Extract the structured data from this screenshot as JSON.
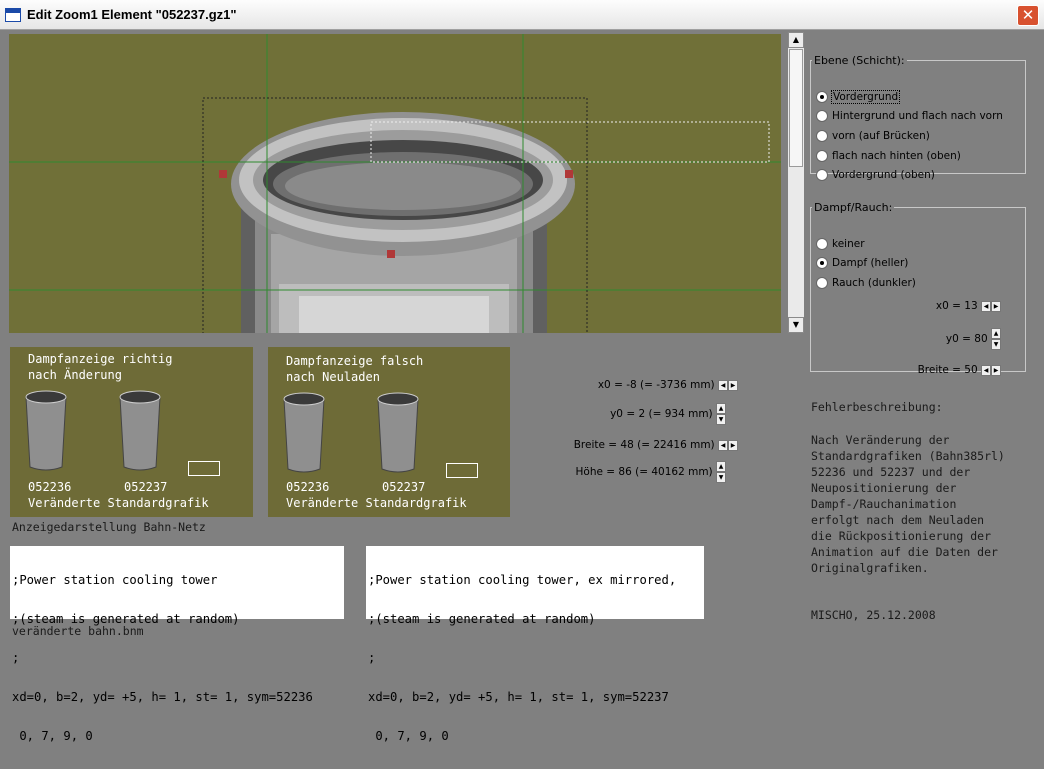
{
  "window": {
    "title": "Edit Zoom1 Element \"052237.gz1\"",
    "close_glyph": "✕"
  },
  "layer_group": {
    "legend": "Ebene (Schicht):",
    "options": [
      "Vordergrund",
      "Hintergrund und flach nach vorn",
      "vorn (auf Brücken)",
      "flach nach hinten (oben)",
      "Vordergrund (oben)"
    ],
    "selected": 0
  },
  "smoke_group": {
    "legend": "Dampf/Rauch:",
    "options": [
      "keiner",
      "Dampf (heller)",
      "Rauch (dunkler)"
    ],
    "selected": 1,
    "x0": "x0 = 13",
    "y0": "y0 = 80",
    "breite": "Breite = 50"
  },
  "fields": {
    "x0": "x0 = -8 (= -3736 mm)",
    "y0": "y0 = 2 (= 934 mm)",
    "breite": "Breite = 48 (= 22416 mm)",
    "hoehe": "Höhe = 86 (= 40162 mm)"
  },
  "panel1": {
    "line1": "Dampfanzeige richtig",
    "line2": "nach Änderung",
    "id1": "052236",
    "id2": "052237",
    "footer": "Veränderte Standardgrafik"
  },
  "panel2": {
    "line1": "Dampfanzeige falsch",
    "line2": "nach Neuladen",
    "id1": "052236",
    "id2": "052237",
    "footer": "Veränderte Standardgrafik"
  },
  "caption1": "Anzeigedarstellung Bahn-Netz",
  "code1": {
    "line1": ";Power station cooling tower",
    "line2": ";(steam is generated at random)",
    "line3": ";",
    "line4": "xd=0, b=2, yd= +5, h= 1, st= 1, sym=52236",
    "line5": " 0, 7, 9, 0"
  },
  "code2": {
    "line1": ";Power station cooling tower, ex mirrored,",
    "line2": ";(steam is generated at random)",
    "line3": ";",
    "line4": "xd=0, b=2, yd= +5, h= 1, st= 1, sym=52237",
    "line5": " 0, 7, 9, 0"
  },
  "caption2": "veränderte bahn.bnm",
  "description": {
    "heading": "Fehlerbeschreibung:",
    "body": "Nach Veränderung der\nStandardgrafiken (Bahn385rl)\n52236 und 52237 und der\nNeupositionierung der\nDampf-/Rauchanimation\nerfolgt nach dem Neuladen\ndie Rückpositionierung der\nAnimation auf die Daten der\nOriginalgrafiken.",
    "signature": "MISCHO, 25.12.2008"
  },
  "colors": {
    "olive": "#6e6b37",
    "canvas": "#707038",
    "guide": "#2f8a2f"
  }
}
